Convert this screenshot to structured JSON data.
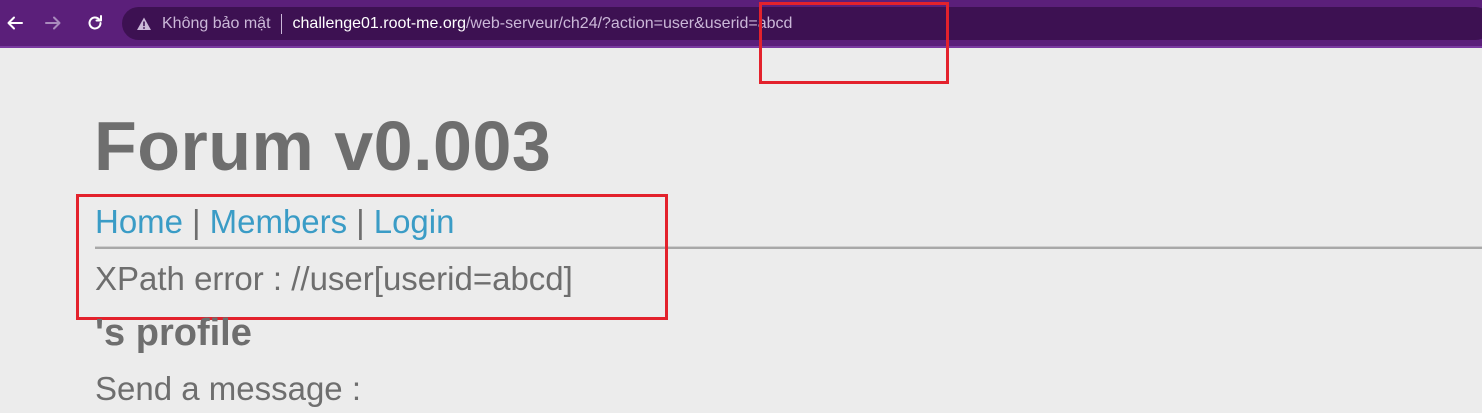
{
  "browser": {
    "security_label": "Không bảo mật",
    "url_host": "challenge01.root-me.org",
    "url_path": "/web-serveur/ch24/?action=user&userid=abcd",
    "icons": {
      "back": "back-arrow-icon",
      "forward": "forward-arrow-icon",
      "reload": "reload-icon",
      "security": "warning-triangle-icon"
    }
  },
  "page": {
    "title": "Forum v0.003",
    "nav": {
      "home": "Home",
      "separator": "|",
      "members": "Members",
      "login": "Login"
    },
    "error": "XPath error : //user[userid=abcd]",
    "profile_heading": "'s profile",
    "send_message": "Send a message :"
  },
  "colors": {
    "browser_bar": "#5b1f7a",
    "omnibox": "#3d1152",
    "link": "#3a9cc6",
    "text": "#6e6e6e",
    "highlight_box": "#e3222c",
    "background": "#ececec"
  }
}
